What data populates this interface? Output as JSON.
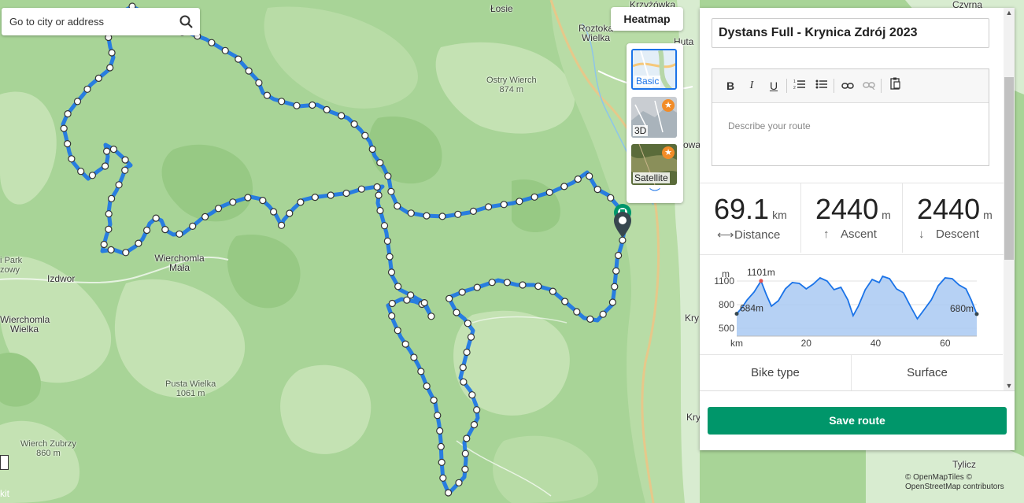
{
  "search": {
    "placeholder": "Go to city or address"
  },
  "heatmap": {
    "label": "Heatmap"
  },
  "layers": [
    {
      "label": "Basic",
      "active": true
    },
    {
      "label": "3D",
      "premium": true
    },
    {
      "label": "Satellite",
      "premium": true
    }
  ],
  "map_labels": {
    "losie": "Łosie",
    "roztoka": "Roztoka Wielka",
    "krzyzowka": "Krzyżówka",
    "huta": "Huta",
    "ostry_wierch": "Ostry Wierch",
    "ostry_wierch_elev": "874 m",
    "park": "i Park",
    "park2": "zowy",
    "izdwor": "Izdwor",
    "wierchomla_mala": "Wierchomla Mała",
    "wierchomla_wielka": "Wierchomla Wielka",
    "pusta_wielka": "Pusta Wielka",
    "pusta_wielka_elev": "1061 m",
    "wierch_zubrzy": "Wierch Zubrzy",
    "wierch_zubrzy_elev": "860 m",
    "kry1": "Kry",
    "kry2": "Kry",
    "owa": "owa",
    "tylicz": "Tylicz",
    "czyrna": "Czyrna",
    "kit": "kit"
  },
  "panel": {
    "route_title": "Dystans Full - Krynica Zdrój 2023",
    "description_placeholder": "Describe your route",
    "toolbar": {
      "bold": "B",
      "italic": "I",
      "underline": "U"
    },
    "stats": {
      "distance": {
        "value": "69.1",
        "unit": "km",
        "label": "Distance"
      },
      "ascent": {
        "value": "2440",
        "unit": "m",
        "label": "Ascent"
      },
      "descent": {
        "value": "2440",
        "unit": "m",
        "label": "Descent"
      }
    },
    "tabs": {
      "bike_type": "Bike type",
      "surface": "Surface"
    },
    "save_label": "Save route"
  },
  "chart_data": {
    "type": "area",
    "ylabel": "m",
    "xlabel": "km",
    "yticks": [
      1100,
      800,
      500
    ],
    "xticks": [
      20,
      40,
      60
    ],
    "ylim": [
      400,
      1250
    ],
    "xlim": [
      0,
      69.1
    ],
    "annotations": [
      {
        "text": "1101m",
        "x": 7,
        "y": 1101
      },
      {
        "text": "684m",
        "x": 0,
        "y": 684
      },
      {
        "text": "680m",
        "x": 69.1,
        "y": 680
      }
    ],
    "x": [
      0,
      1.5,
      3,
      5,
      7,
      8.5,
      10,
      12,
      14,
      16,
      18,
      20,
      22,
      24,
      26,
      28,
      30,
      32,
      33.5,
      35,
      37,
      39,
      41,
      42,
      44,
      46,
      48,
      50,
      52,
      54,
      56,
      58,
      60,
      62,
      64,
      66,
      67.5,
      69.1
    ],
    "y": [
      684,
      760,
      860,
      960,
      1101,
      930,
      780,
      850,
      1000,
      1080,
      1070,
      1000,
      1060,
      1140,
      1100,
      990,
      1020,
      860,
      660,
      780,
      990,
      1120,
      1080,
      1160,
      1130,
      1000,
      950,
      780,
      620,
      740,
      860,
      1040,
      1140,
      1130,
      1050,
      1000,
      860,
      680
    ]
  },
  "attribution": "© OpenMapTiles © OpenStreetMap contributors",
  "colors": {
    "route": "#1a73e8",
    "save": "#00966a",
    "map": "#a8d497"
  }
}
